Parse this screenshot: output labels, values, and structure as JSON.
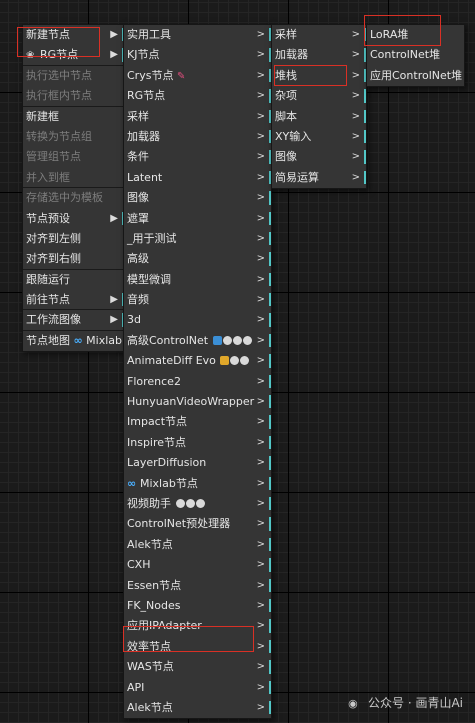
{
  "menu1": {
    "items": [
      {
        "label": "新建节点",
        "arrow": "▶",
        "disabled": false,
        "submenu": true
      },
      {
        "label": "RG节点",
        "arrow": "▶",
        "disabled": false,
        "submenu": true
      },
      {
        "label": "执行选中节点",
        "disabled": true
      },
      {
        "label": "执行框内节点",
        "disabled": true
      },
      {
        "label": "新建框",
        "disabled": false
      },
      {
        "label": "转换为节点组",
        "disabled": true
      },
      {
        "label": "管理组节点",
        "disabled": true
      },
      {
        "label": "并入到框",
        "disabled": true
      },
      {
        "label": "存储选中为模板",
        "disabled": true
      },
      {
        "label": "节点预设",
        "arrow": "▶",
        "disabled": false,
        "submenu": true
      },
      {
        "label": "对齐到左侧",
        "disabled": false
      },
      {
        "label": "对齐到右侧",
        "disabled": false
      },
      {
        "label": "跟随运行",
        "disabled": false
      },
      {
        "label": "前往节点",
        "arrow": "▶",
        "disabled": false,
        "submenu": true
      },
      {
        "label": "工作流图像",
        "arrow": "▶",
        "disabled": false,
        "submenu": true
      },
      {
        "label": "节点地图",
        "suffix": "Mixlab",
        "disabled": false
      }
    ]
  },
  "menu2": {
    "items": [
      {
        "label": "实用工具",
        "arrow": ">"
      },
      {
        "label": "KJ节点",
        "arrow": ">"
      },
      {
        "label": "Crys节点",
        "arrow": ">"
      },
      {
        "label": "RG节点",
        "arrow": ">"
      },
      {
        "label": "采样",
        "arrow": ">"
      },
      {
        "label": "加载器",
        "arrow": ">"
      },
      {
        "label": "条件",
        "arrow": ">"
      },
      {
        "label": "Latent",
        "arrow": ">"
      },
      {
        "label": "图像",
        "arrow": ">"
      },
      {
        "label": "遮罩",
        "arrow": ">"
      },
      {
        "label": "_用于测试",
        "arrow": ">"
      },
      {
        "label": "高级",
        "arrow": ">"
      },
      {
        "label": "模型微调",
        "arrow": ">"
      },
      {
        "label": "音频",
        "arrow": ">"
      },
      {
        "label": "3d",
        "arrow": ">"
      },
      {
        "label": "高级ControlNet",
        "arrow": ">"
      },
      {
        "label": "AnimateDiff Evo",
        "arrow": ">"
      },
      {
        "label": "Florence2",
        "arrow": ">"
      },
      {
        "label": "HunyuanVideoWrapper",
        "arrow": ">"
      },
      {
        "label": "Impact节点",
        "arrow": ">"
      },
      {
        "label": "Inspire节点",
        "arrow": ">"
      },
      {
        "label": "LayerDiffusion",
        "arrow": ">"
      },
      {
        "label": "Mixlab节点",
        "arrow": ">"
      },
      {
        "label": "视频助手",
        "arrow": ">"
      },
      {
        "label": "ControlNet预处理器",
        "arrow": ">"
      },
      {
        "label": "Alek节点",
        "arrow": ">"
      },
      {
        "label": "CXH",
        "arrow": ">"
      },
      {
        "label": "Essen节点",
        "arrow": ">"
      },
      {
        "label": "FK_Nodes",
        "arrow": ">"
      },
      {
        "label": "应用IPAdapter",
        "arrow": ">"
      },
      {
        "label": "效率节点",
        "arrow": ">"
      },
      {
        "label": "WAS节点",
        "arrow": ">"
      },
      {
        "label": "API",
        "arrow": ">"
      },
      {
        "label": "Alek节点",
        "arrow": ">"
      }
    ]
  },
  "menu3": {
    "items": [
      {
        "label": "采样",
        "arrow": ">"
      },
      {
        "label": "加载器",
        "arrow": ">"
      },
      {
        "label": "堆栈",
        "arrow": ">"
      },
      {
        "label": "杂项",
        "arrow": ">"
      },
      {
        "label": "脚本",
        "arrow": ">"
      },
      {
        "label": "XY输入",
        "arrow": ">"
      },
      {
        "label": "图像",
        "arrow": ">"
      },
      {
        "label": "简易运算",
        "arrow": ">"
      }
    ]
  },
  "menu4": {
    "items": [
      {
        "label": "LoRA堆"
      },
      {
        "label": "ControlNet堆"
      },
      {
        "label": "应用ControlNet堆"
      }
    ]
  },
  "watermark": {
    "text": "公众号 · 画青山Ai",
    "icon": "wechat-icon"
  },
  "colors": {
    "menu_bg": "#353535",
    "text": "#e6e6e6",
    "disabled_text": "#7d7d7d",
    "submenu_marker": "#52c7c7",
    "highlight_box": "#d93025"
  }
}
